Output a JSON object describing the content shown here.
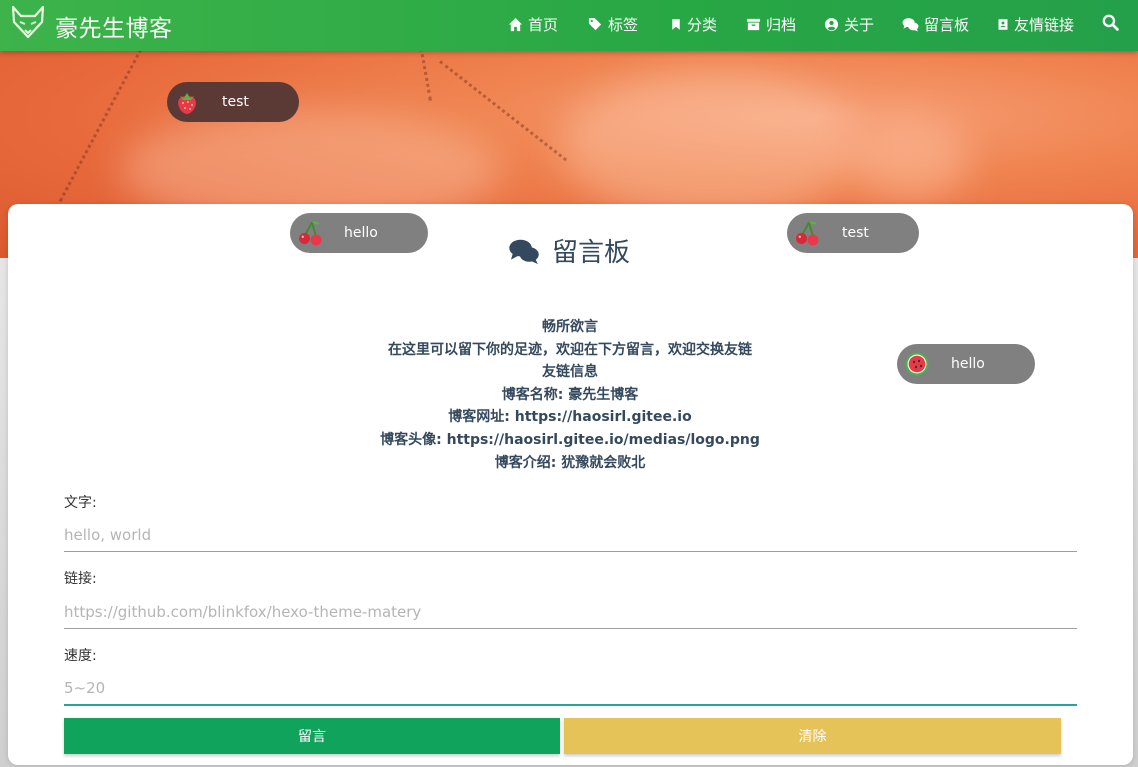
{
  "navbar": {
    "brand": "豪先生博客",
    "items": [
      {
        "label": "首页",
        "icon": "home-icon"
      },
      {
        "label": "标签",
        "icon": "tags-icon"
      },
      {
        "label": "分类",
        "icon": "bookmark-icon"
      },
      {
        "label": "归档",
        "icon": "archive-icon"
      },
      {
        "label": "关于",
        "icon": "user-circle-icon"
      },
      {
        "label": "留言板",
        "icon": "comments-icon"
      },
      {
        "label": "友情链接",
        "icon": "address-book-icon"
      }
    ],
    "search_icon": "search-icon"
  },
  "page": {
    "title": "留言板",
    "title_icon": "comments-icon",
    "intro": [
      "畅所欲言",
      "在这里可以留下你的足迹，欢迎在下方留言，欢迎交换友链",
      "友链信息",
      "博客名称: 豪先生博客",
      "博客网址: https://haosirl.gitee.io",
      "博客头像: https://haosirl.gitee.io/medias/logo.png",
      "博客介绍: 犹豫就会败北"
    ]
  },
  "form": {
    "text_label": "文字:",
    "text_placeholder": "hello, world",
    "link_label": "链接:",
    "link_placeholder": "https://github.com/blinkfox/hexo-theme-matery",
    "speed_label": "速度:",
    "speed_placeholder": "5~20",
    "submit_label": "留言",
    "clear_label": "清除"
  },
  "barrages": [
    {
      "text": "test",
      "emoji": "strawberry"
    },
    {
      "text": "hello",
      "emoji": "cherry"
    },
    {
      "text": "test",
      "emoji": "cherry"
    },
    {
      "text": "hello",
      "emoji": "watermelon"
    }
  ],
  "colors": {
    "navbar": "#28a745",
    "submit": "#0fa35c",
    "clear": "#e6c358",
    "title": "#34495e",
    "barrage_dark": "#5b3a36",
    "barrage_gray": "#808080"
  }
}
